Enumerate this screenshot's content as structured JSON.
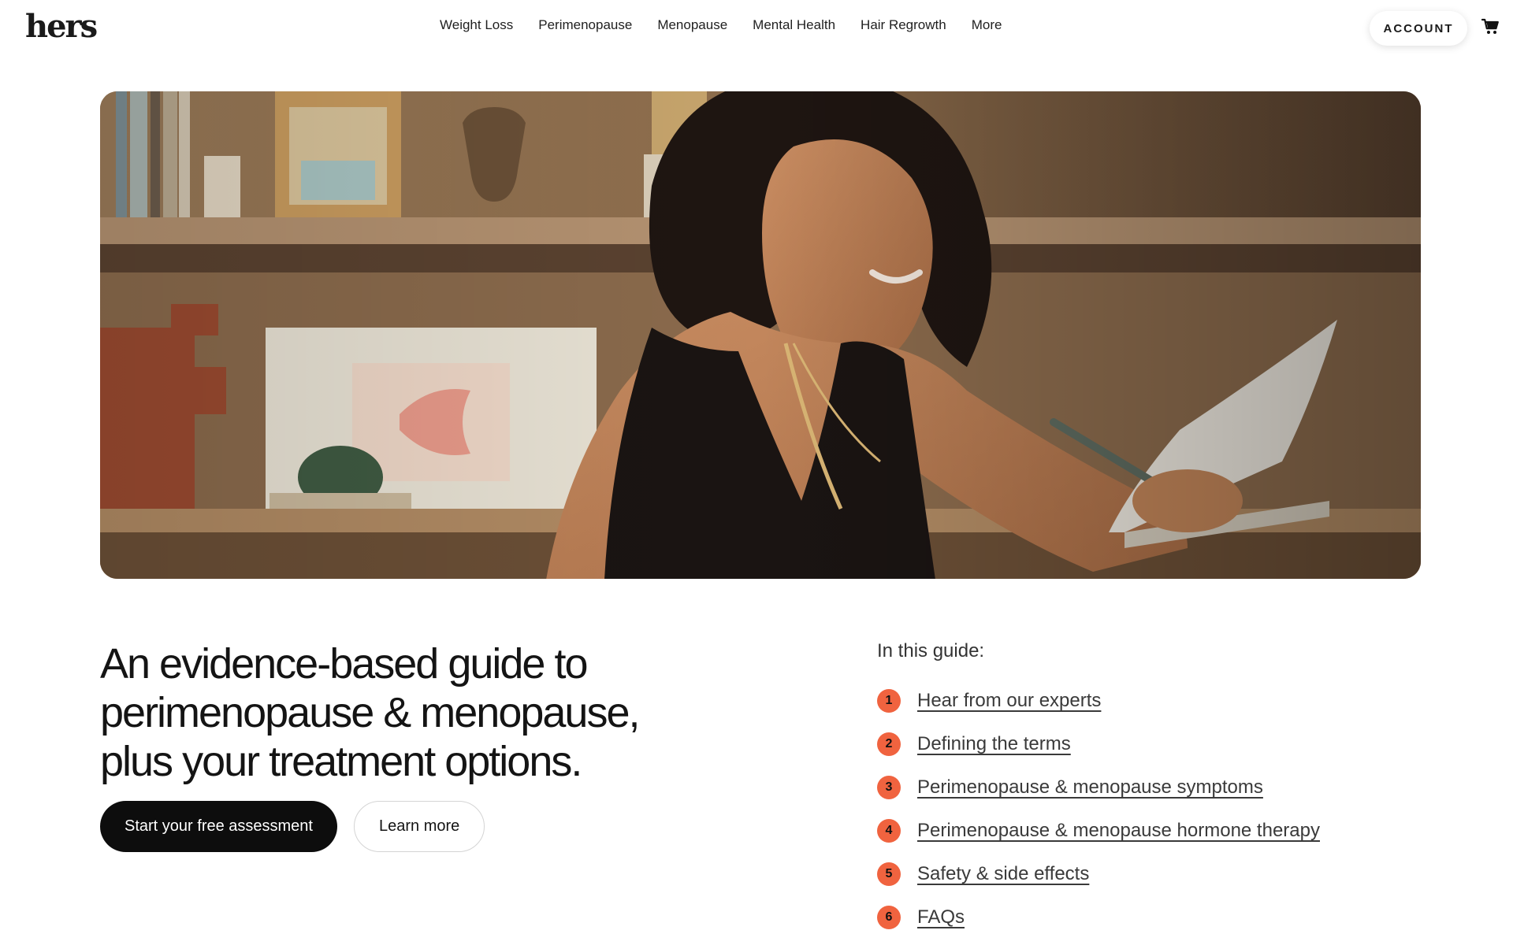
{
  "header": {
    "logo": "hers",
    "nav": [
      {
        "label": "Weight Loss"
      },
      {
        "label": "Perimenopause"
      },
      {
        "label": "Menopause"
      },
      {
        "label": "Mental Health"
      },
      {
        "label": "Hair Regrowth"
      },
      {
        "label": "More"
      }
    ],
    "account_label": "ACCOUNT",
    "cart_icon": "shopping-cart-icon"
  },
  "hero": {
    "image": "woman-writing-in-notebook-photo"
  },
  "main": {
    "headline": "An evidence-based guide to perimenopause & menopause, plus your treatment options.",
    "primary_cta": "Start your free assessment",
    "secondary_cta": "Learn more"
  },
  "guide": {
    "title": "In this guide:",
    "items": [
      {
        "num": "1",
        "label": "Hear from our experts"
      },
      {
        "num": "2",
        "label": "Defining the terms"
      },
      {
        "num": "3",
        "label": "Perimenopause & menopause symptoms"
      },
      {
        "num": "4",
        "label": "Perimenopause & menopause hormone therapy"
      },
      {
        "num": "5",
        "label": "Safety & side effects"
      },
      {
        "num": "6",
        "label": "FAQs"
      }
    ]
  },
  "colors": {
    "accent": "#f0633f",
    "primary_button": "#0d0d0d"
  }
}
